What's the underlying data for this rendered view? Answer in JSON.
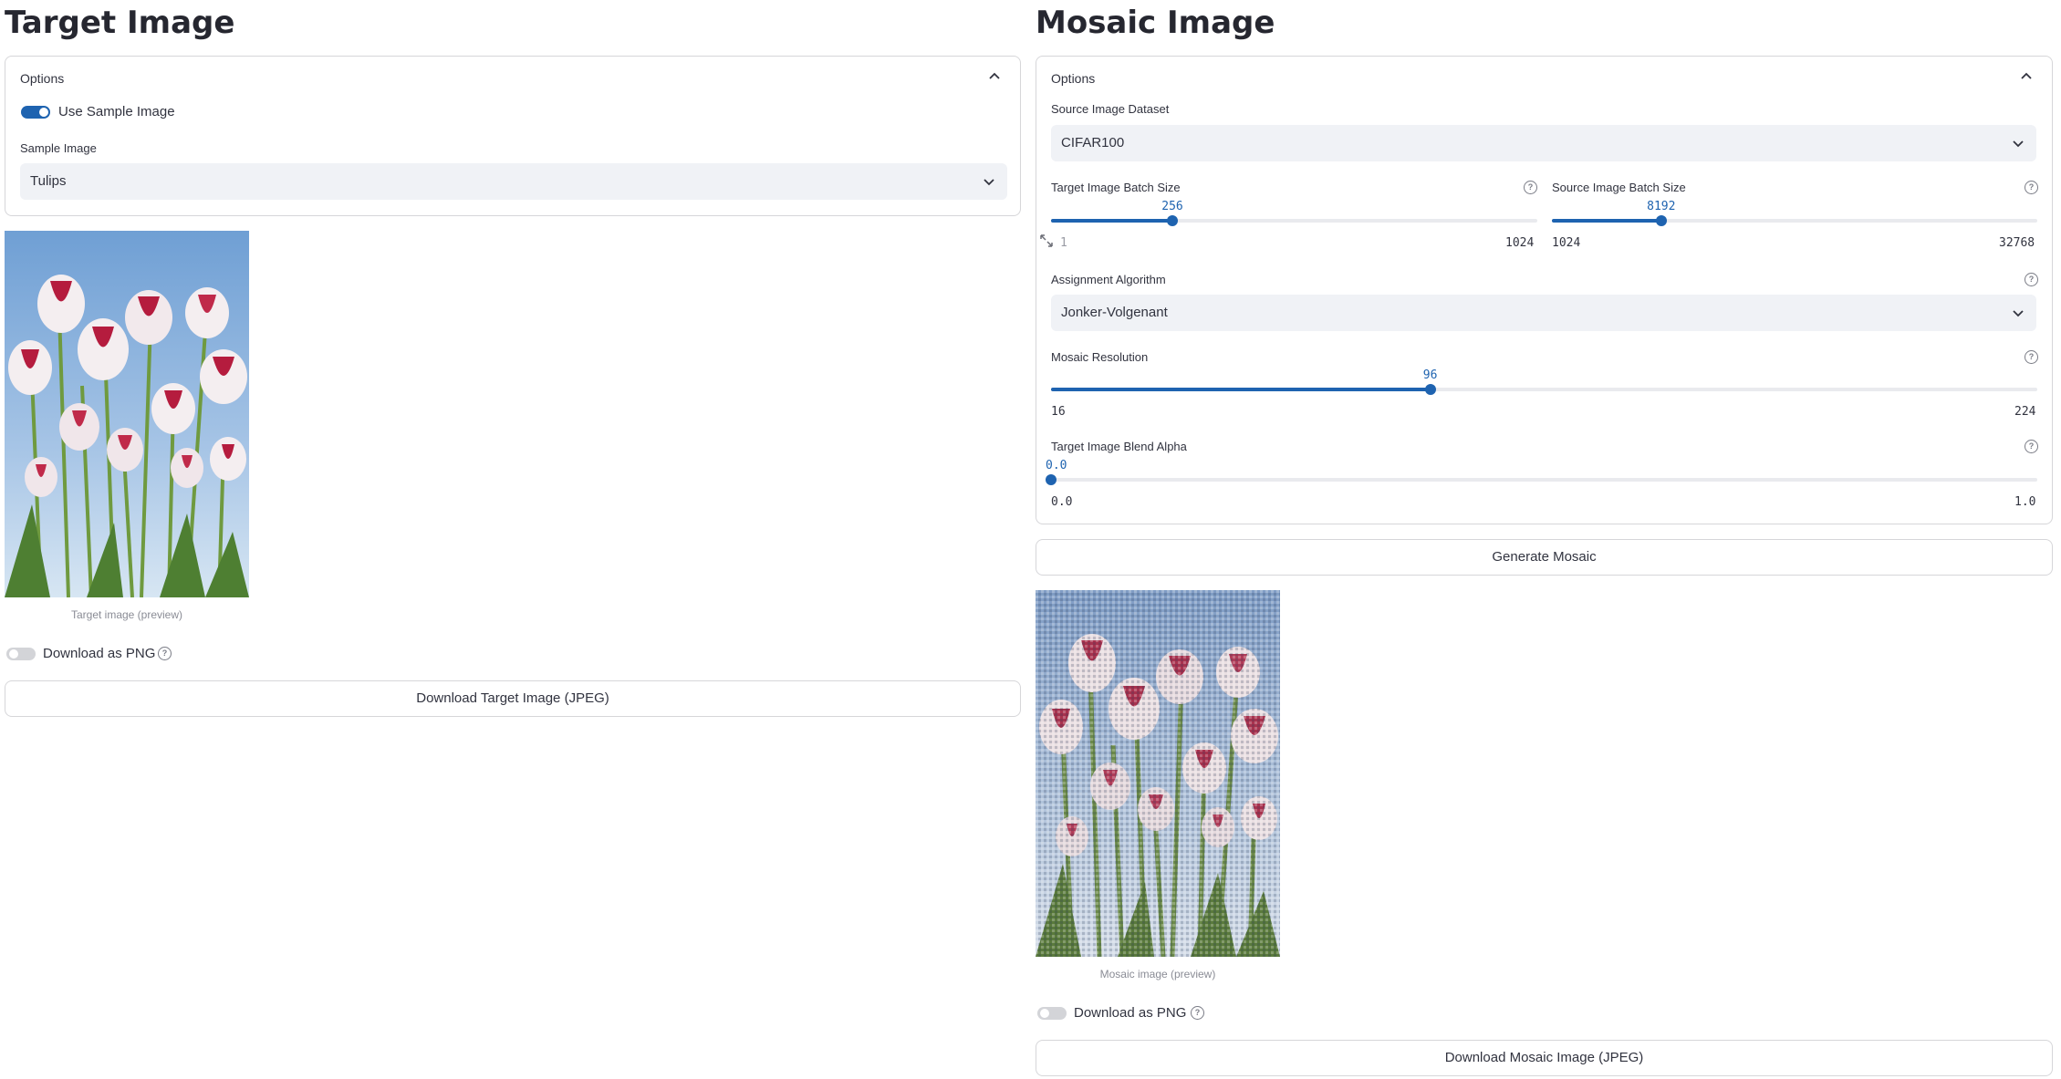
{
  "target": {
    "title": "Target Image",
    "options_label": "Options",
    "use_sample_label": "Use Sample Image",
    "use_sample_on": true,
    "sample_label": "Sample Image",
    "sample_value": "Tulips",
    "caption": "Target image (preview)",
    "png_toggle_label": "Download as PNG",
    "png_toggle_on": false,
    "download_label": "Download Target Image (JPEG)"
  },
  "mosaic": {
    "title": "Mosaic Image",
    "options_label": "Options",
    "dataset_label": "Source Image Dataset",
    "dataset_value": "CIFAR100",
    "target_batch": {
      "label": "Target Image Batch Size",
      "value": "256",
      "min": "1",
      "max": "1024"
    },
    "source_batch": {
      "label": "Source Image Batch Size",
      "value": "8192",
      "min": "1024",
      "max": "32768"
    },
    "algorithm_label": "Assignment Algorithm",
    "algorithm_value": "Jonker-Volgenant",
    "resolution": {
      "label": "Mosaic Resolution",
      "value": "96",
      "min": "16",
      "max": "224"
    },
    "alpha": {
      "label": "Target Image Blend Alpha",
      "value": "0.0",
      "min": "0.0",
      "max": "1.0"
    },
    "generate_label": "Generate Mosaic",
    "caption": "Mosaic image (preview)",
    "png_toggle_label": "Download as PNG",
    "png_toggle_on": false,
    "download_label": "Download Mosaic Image (JPEG)"
  },
  "sliders": {
    "target_batch_frac": 0.25,
    "source_batch_frac": 0.2258,
    "resolution_frac": 0.3846,
    "alpha_frac": 0.0
  },
  "colors": {
    "accent": "#1e63b0",
    "border": "#d6d6d9",
    "select_bg": "#f0f2f6",
    "text": "#31333f"
  },
  "icons": {
    "collapse": "chevron-up-icon",
    "dropdown": "chevron-down-icon",
    "help": "help-circle-icon",
    "fullscreen": "fullscreen-icon"
  }
}
